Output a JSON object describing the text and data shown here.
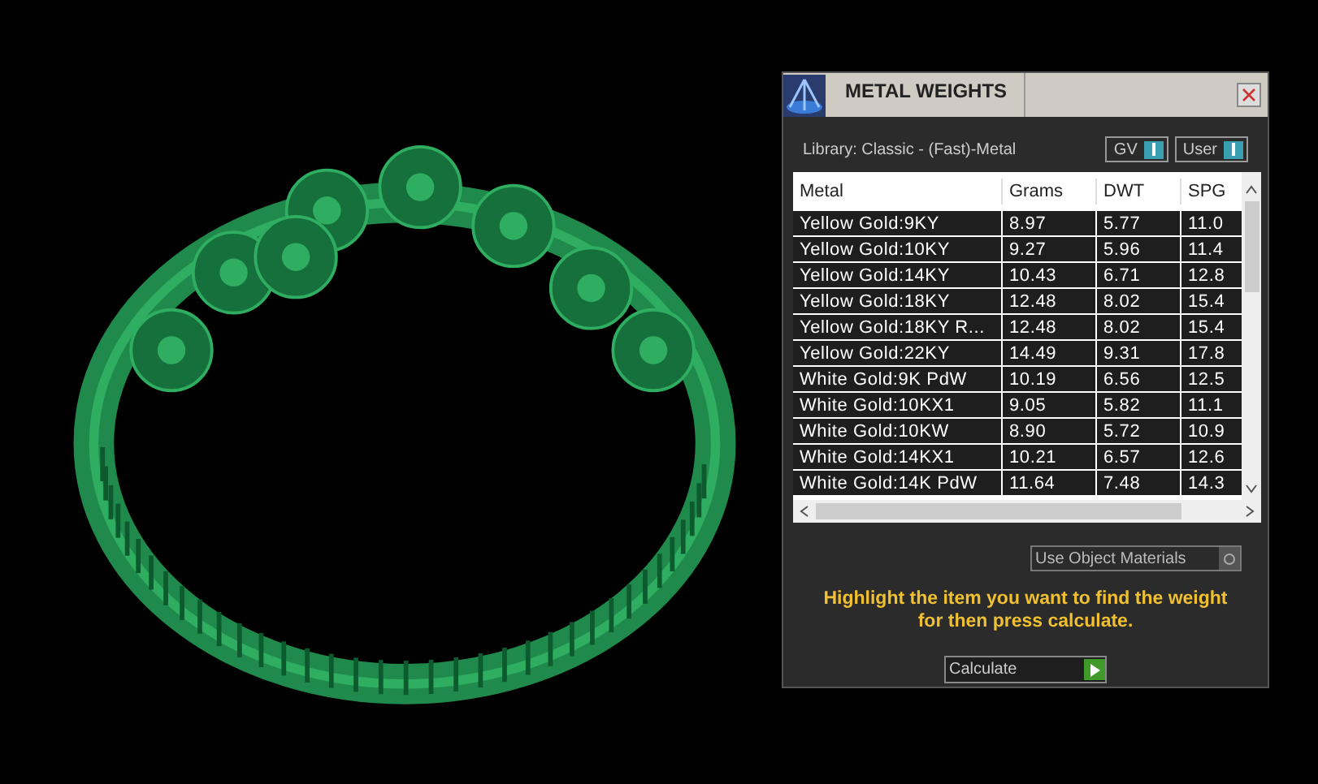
{
  "panel": {
    "title": "METAL WEIGHTS",
    "library": "Library: Classic - (Fast)-Metal",
    "toggles": [
      {
        "label": "GV",
        "on": true
      },
      {
        "label": "User",
        "on": true
      }
    ],
    "table": {
      "columns": [
        "Metal",
        "Grams",
        "DWT",
        "SPG"
      ],
      "rows": [
        {
          "cells": [
            "Yellow Gold:9KY",
            "8.97",
            "5.77",
            "11.0"
          ]
        },
        {
          "cells": [
            "Yellow Gold:10KY",
            "9.27",
            "5.96",
            "11.4"
          ]
        },
        {
          "cells": [
            "Yellow Gold:14KY",
            "10.43",
            "6.71",
            "12.8"
          ]
        },
        {
          "cells": [
            "Yellow Gold:18KY",
            "12.48",
            "8.02",
            "15.4"
          ]
        },
        {
          "cells": [
            "Yellow Gold:18KY R...",
            "12.48",
            "8.02",
            "15.4"
          ]
        },
        {
          "cells": [
            "Yellow Gold:22KY",
            "14.49",
            "9.31",
            "17.8"
          ]
        },
        {
          "cells": [
            "White Gold:9K PdW",
            "10.19",
            "6.56",
            "12.5"
          ]
        },
        {
          "cells": [
            "White Gold:10KX1",
            "9.05",
            "5.82",
            "11.1"
          ]
        },
        {
          "cells": [
            "White Gold:10KW",
            "8.90",
            "5.72",
            "10.9"
          ]
        },
        {
          "cells": [
            "White Gold:14KX1",
            "10.21",
            "6.57",
            "12.6"
          ]
        },
        {
          "cells": [
            "White Gold:14K PdW",
            "11.64",
            "7.48",
            "14.3"
          ]
        }
      ]
    },
    "use_object_materials": {
      "label": "Use Object Materials",
      "checked": false
    },
    "hint": "Highlight the item you want to find the weight for then press calculate.",
    "calculate_button": "Calculate"
  }
}
